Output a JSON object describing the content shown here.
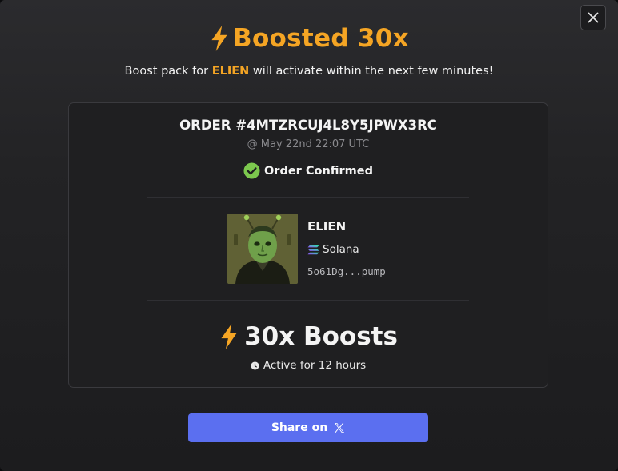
{
  "modal": {
    "title_prefix_icon": "lightning-bolt-icon",
    "title": "Boosted 30x",
    "subtitle_before": "Boost pack for ",
    "subtitle_token": "ELIEN",
    "subtitle_after": " will activate within the next few minutes!",
    "close_icon": "close-icon"
  },
  "order": {
    "id": "ORDER #4MTZRCUJ4L8Y5JPWX3RC",
    "time": "@ May 22nd 22:07 UTC",
    "status": "Order Confirmed",
    "status_icon": "check-circle-icon"
  },
  "token": {
    "name": "ELIEN",
    "chain": "Solana",
    "chain_icon": "solana-icon",
    "address": "5o61Dg...pump",
    "avatar": "token-avatar"
  },
  "boost": {
    "icon": "lightning-bolt-icon",
    "label": "30x Boosts",
    "duration": "Active for 12 hours",
    "duration_icon": "clock-icon"
  },
  "share": {
    "label": "Share on",
    "icon": "x-logo-icon"
  },
  "colors": {
    "accent": "#f5a524",
    "button": "#5b6ff0",
    "success": "#7cc84e"
  }
}
